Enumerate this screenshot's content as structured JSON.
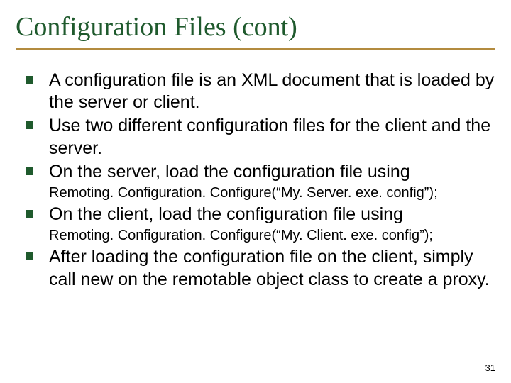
{
  "title": "Configuration Files (cont)",
  "bullets": [
    {
      "text": "A configuration file is an XML document that is loaded by the server or client."
    },
    {
      "text": "Use two different configuration files for the client and the server."
    },
    {
      "text": "On the server, load the configuration file using"
    }
  ],
  "code1": "Remoting. Configuration. Configure(“My. Server. exe. config”);",
  "bullet4": "On the client, load the configuration file using",
  "code2": "Remoting. Configuration. Configure(“My. Client. exe. config”);",
  "bullet5": "After loading the configuration file on the client, simply call new on the remotable object class to create a proxy.",
  "page_number": "31"
}
